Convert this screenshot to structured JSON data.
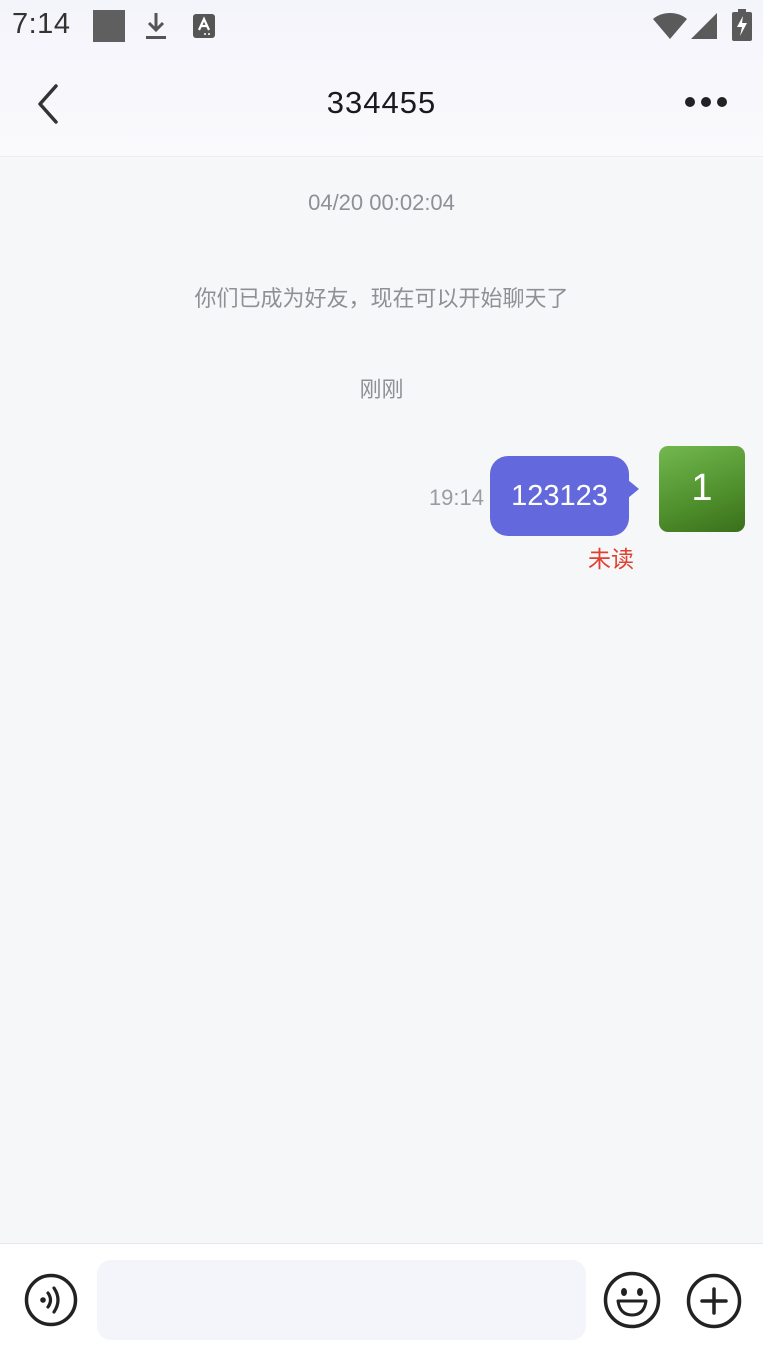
{
  "status_bar": {
    "time": "7:14",
    "icons": [
      "notification-square-icon",
      "download-icon",
      "text-recognition-icon",
      "wifi-icon",
      "cellular-signal-icon",
      "battery-charging-icon"
    ]
  },
  "nav": {
    "title": "334455",
    "back_icon": "chevron-left-icon",
    "more_icon": "more-horizontal-icon"
  },
  "chat": {
    "date_stamp": "04/20 00:02:04",
    "system_notice": "你们已成为好友，现在可以开始聊天了",
    "relative_time": "刚刚",
    "messages": [
      {
        "time": "19:14",
        "text": "123123",
        "status": "未读",
        "avatar_text": "1",
        "sender": "self"
      }
    ]
  },
  "input_bar": {
    "value": "",
    "placeholder": "",
    "icons": [
      "voice-icon",
      "emoji-icon",
      "plus-icon"
    ]
  },
  "colors": {
    "bubble": "#6369dc",
    "unread": "#e0402f",
    "avatar": "#4f8f2c",
    "background": "#f6f7f9"
  }
}
